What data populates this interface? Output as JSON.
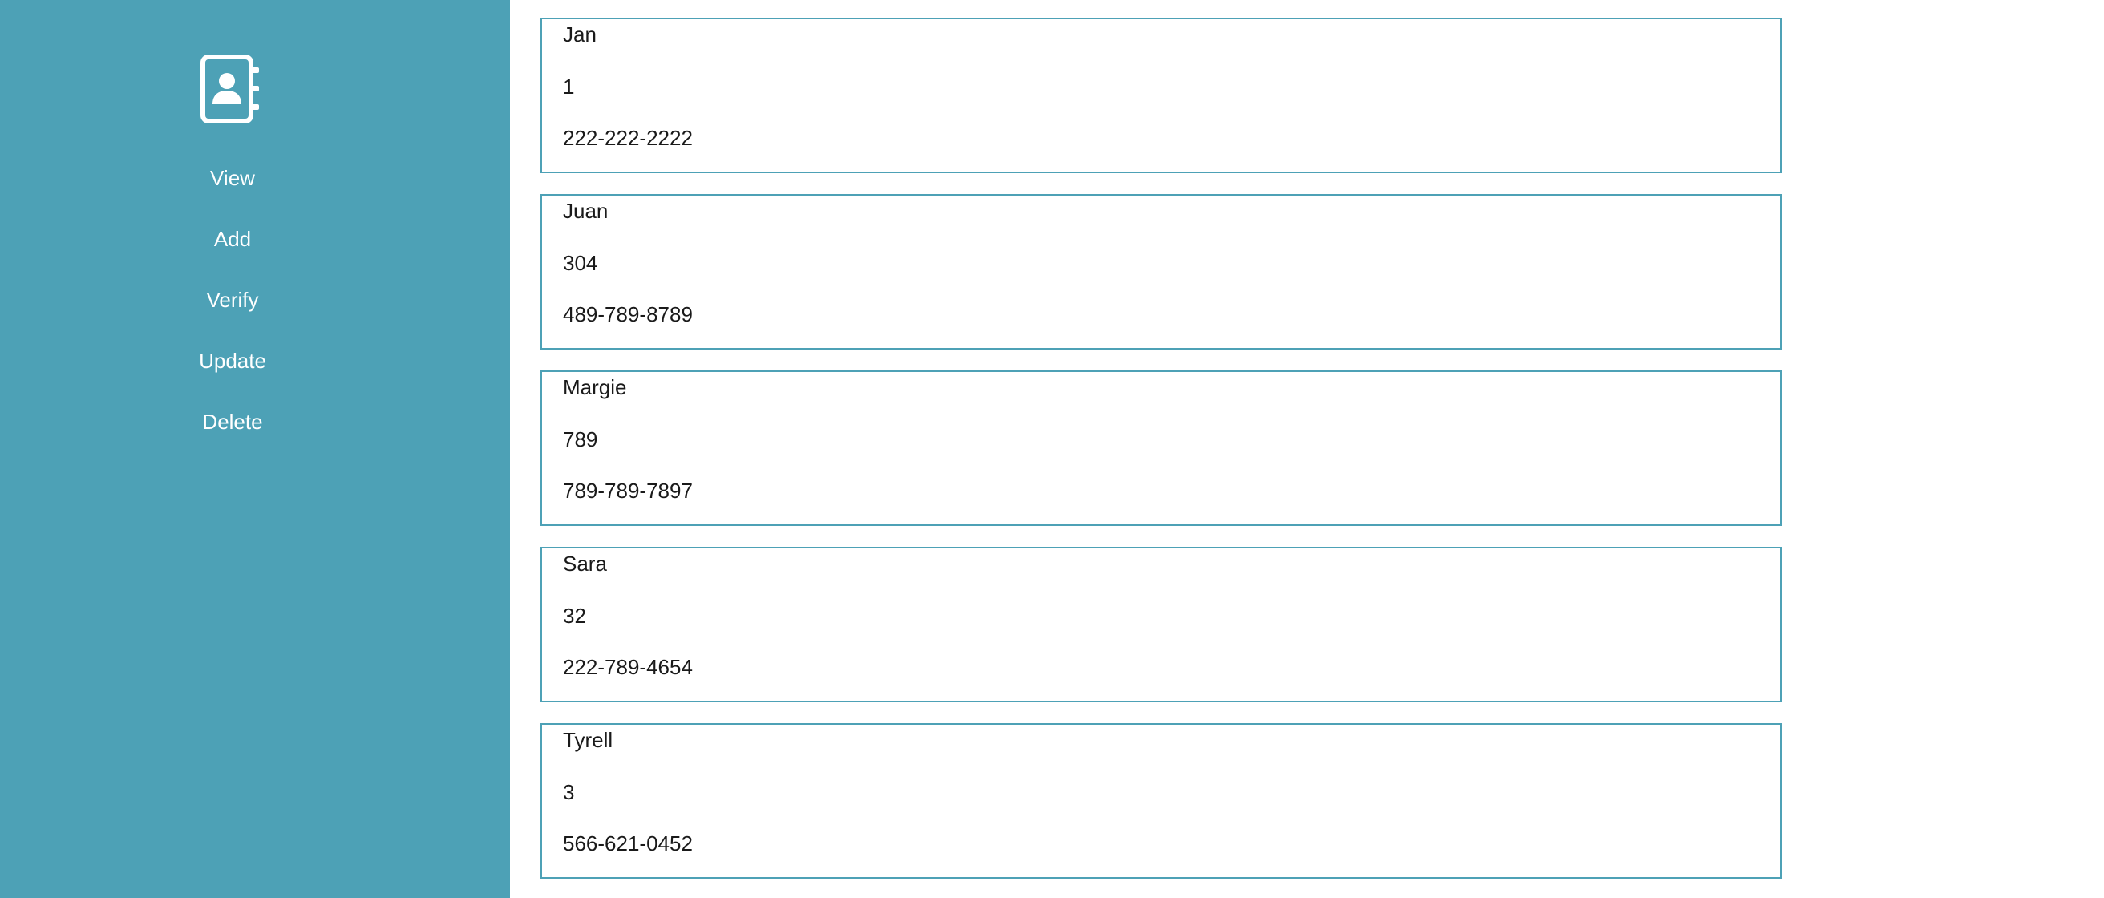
{
  "sidebar": {
    "logo_icon": "contact-book-icon",
    "background_color": "#4da1b6",
    "nav": [
      {
        "label": "View"
      },
      {
        "label": "Add"
      },
      {
        "label": "Verify"
      },
      {
        "label": "Update"
      },
      {
        "label": "Delete"
      }
    ]
  },
  "contacts": [
    {
      "name": "Jan",
      "id": "1",
      "phone": "222-222-2222"
    },
    {
      "name": "Juan",
      "id": "304",
      "phone": "489-789-8789"
    },
    {
      "name": "Margie",
      "id": "789",
      "phone": "789-789-7897"
    },
    {
      "name": "Sara",
      "id": "32",
      "phone": "222-789-4654"
    },
    {
      "name": "Tyrell",
      "id": "3",
      "phone": "566-621-0452"
    }
  ],
  "colors": {
    "accent": "#4da1b6",
    "text": "#1a1a1a",
    "nav_text": "#ffffff"
  }
}
